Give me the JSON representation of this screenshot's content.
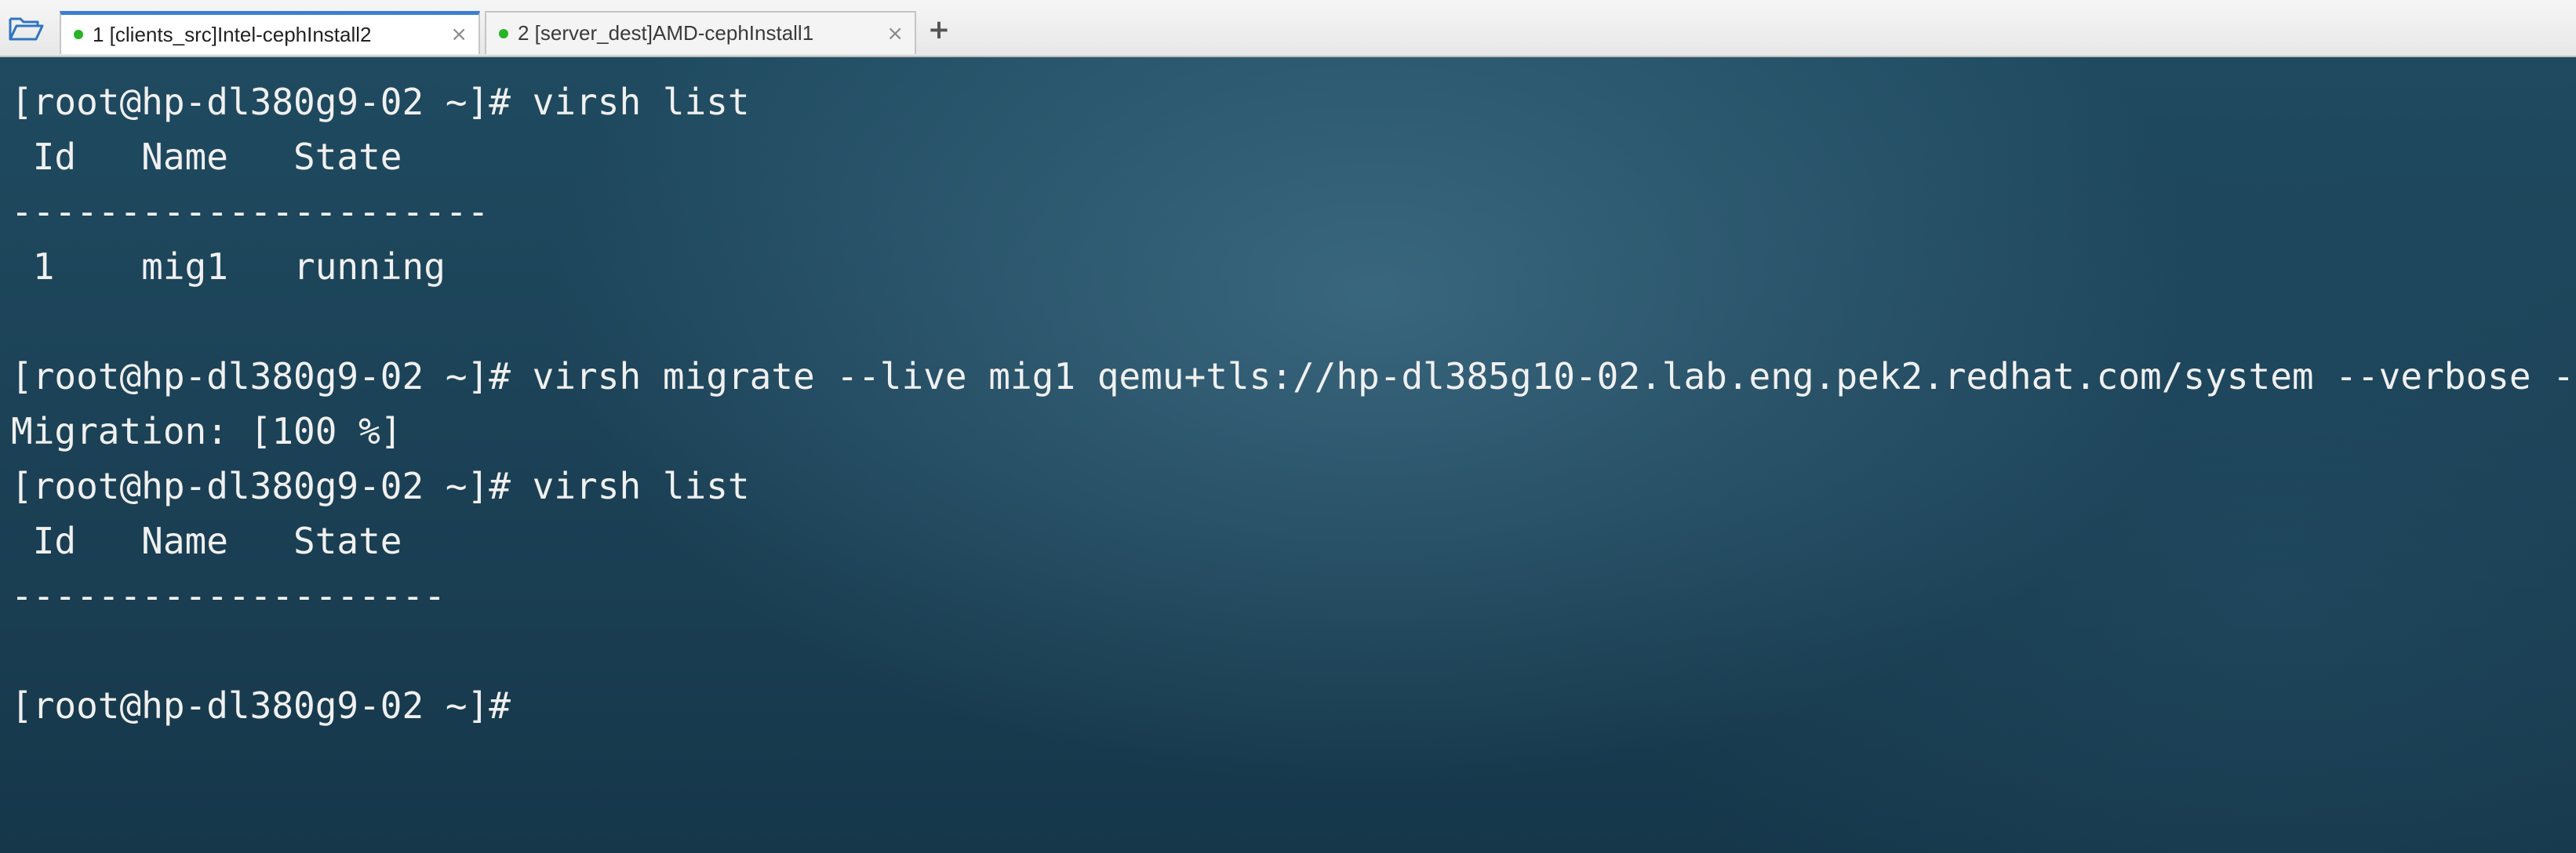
{
  "tabbar": {
    "open_icon": "folder-open-icon",
    "tabs": [
      {
        "label": "1 [clients_src]Intel-cephInstall2",
        "status_color": "#27b427",
        "active": true,
        "close": "×"
      },
      {
        "label": "2 [server_dest]AMD-cephInstall1",
        "status_color": "#27b427",
        "active": false,
        "close": "×"
      }
    ],
    "new_tab": "+"
  },
  "terminal": {
    "lines": [
      "[root@hp-dl380g9-02 ~]# virsh list",
      " Id   Name   State",
      "----------------------",
      " 1    mig1   running",
      "",
      "[root@hp-dl380g9-02 ~]# virsh migrate --live mig1 qemu+tls://hp-dl385g10-02.lab.eng.pek2.redhat.com/system --verbose --unsafe",
      "Migration: [100 %]",
      "[root@hp-dl380g9-02 ~]# virsh list",
      " Id   Name   State",
      "--------------------",
      "",
      "[root@hp-dl380g9-02 ~]#"
    ]
  },
  "colors": {
    "terminal_background": "#1c4257",
    "terminal_text": "#f0f0f0",
    "active_tab_accent": "#3a7fd0",
    "status_dot": "#27b427"
  }
}
